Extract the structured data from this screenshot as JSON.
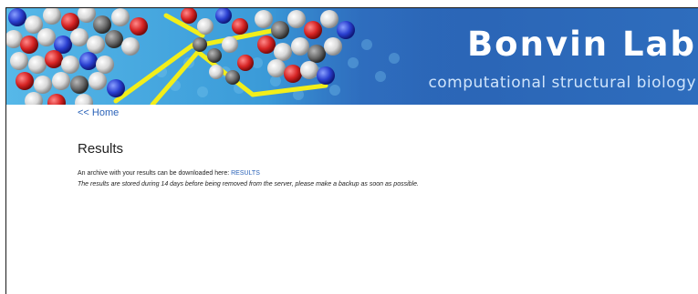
{
  "banner": {
    "title": "Bonvin Lab",
    "subtitle": "computational structural biology",
    "image_name": "molecular-structure-illustration"
  },
  "nav": {
    "home_link": "<< Home"
  },
  "main": {
    "title": "Results",
    "archive_text": "An archive with your results can be downloaded here: ",
    "results_link": "RESULTS",
    "notice": "The results are stored during 14 days before being removed from the server, please make a backup as soon as possible."
  },
  "colors": {
    "link": "#2a62b8",
    "banner_blue": "#2f6fc0",
    "text": "#222222"
  }
}
